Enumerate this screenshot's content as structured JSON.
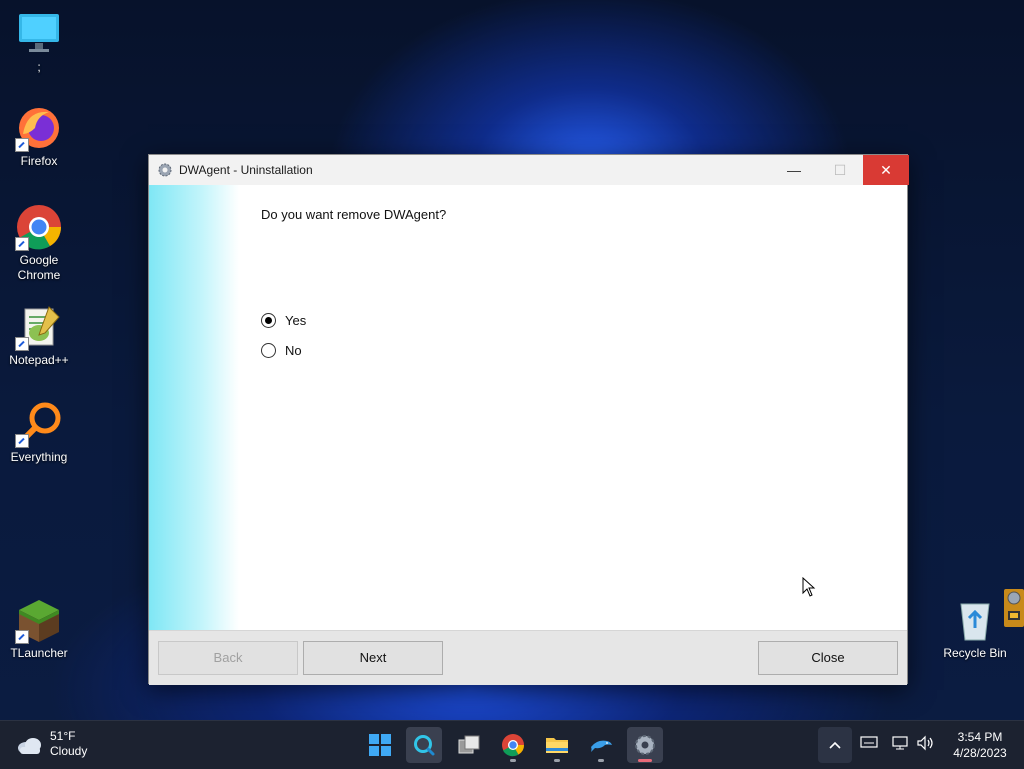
{
  "desktop": {
    "icons": [
      {
        "label": ";"
      },
      {
        "label": "Firefox"
      },
      {
        "label": "Google Chrome"
      },
      {
        "label": "Notepad++"
      },
      {
        "label": "Everything"
      },
      {
        "label": "TLauncher"
      },
      {
        "label": "Recycle Bin"
      }
    ]
  },
  "window": {
    "title": "DWAgent - Uninstallation",
    "minimize_glyph": "—",
    "maximize_glyph": "☐",
    "close_glyph": "✕",
    "question": "Do you want remove DWAgent?",
    "options": [
      {
        "label": "Yes",
        "checked": true
      },
      {
        "label": "No",
        "checked": false
      }
    ],
    "buttons": {
      "back": "Back",
      "next": "Next",
      "close": "Close"
    }
  },
  "taskbar": {
    "weather": {
      "temp": "51°F",
      "condition": "Cloudy"
    },
    "clock": {
      "time": "3:54 PM",
      "date": "4/28/2023"
    },
    "tray_chevron": "^"
  }
}
